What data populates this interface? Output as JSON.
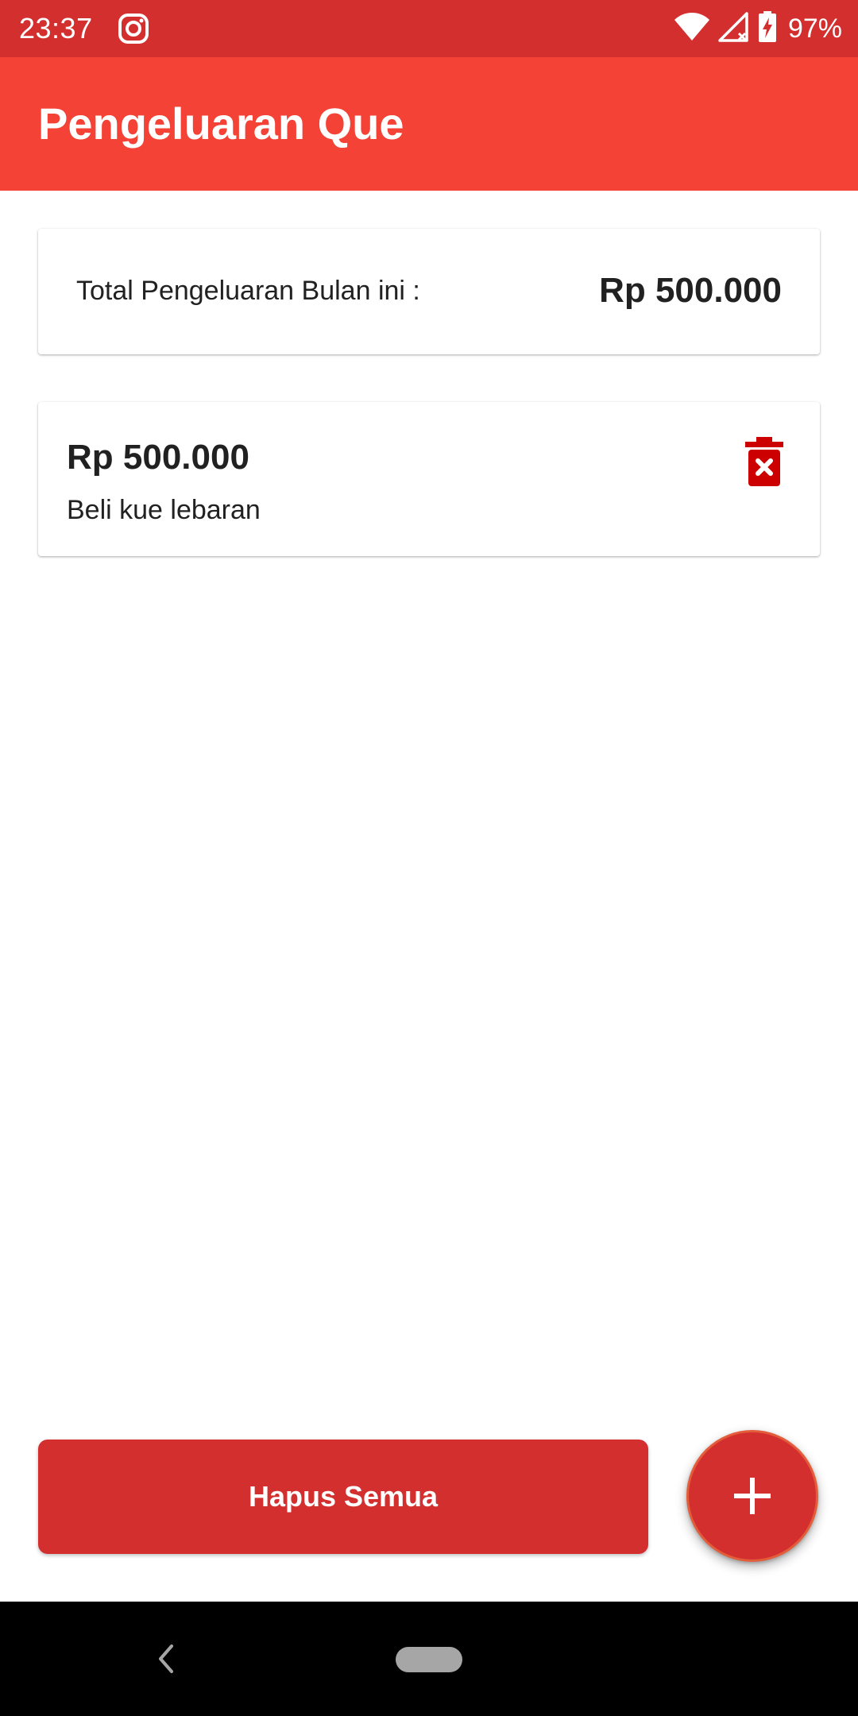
{
  "status_bar": {
    "time": "23:37",
    "battery": "97%",
    "icons": [
      "instagram-icon",
      "wifi-icon",
      "signal-off-icon",
      "battery-charging-icon"
    ]
  },
  "app_bar": {
    "title": "Pengeluaran Que"
  },
  "summary": {
    "label": "Total Pengeluaran Bulan ini :",
    "value": "Rp 500.000"
  },
  "expenses": [
    {
      "amount": "Rp 500.000",
      "description": "Beli kue lebaran",
      "action_icon": "delete-icon"
    }
  ],
  "actions": {
    "clear_all_label": "Hapus Semua",
    "fab_icon": "plus-icon"
  },
  "navigation": {
    "icons": [
      "back-icon",
      "home-pill-icon"
    ]
  },
  "colors": {
    "status_bar": "#d32f2f",
    "app_bar": "#f44336",
    "accent": "#d32f2f",
    "delete_icon": "#cc0000",
    "text": "#212121"
  }
}
